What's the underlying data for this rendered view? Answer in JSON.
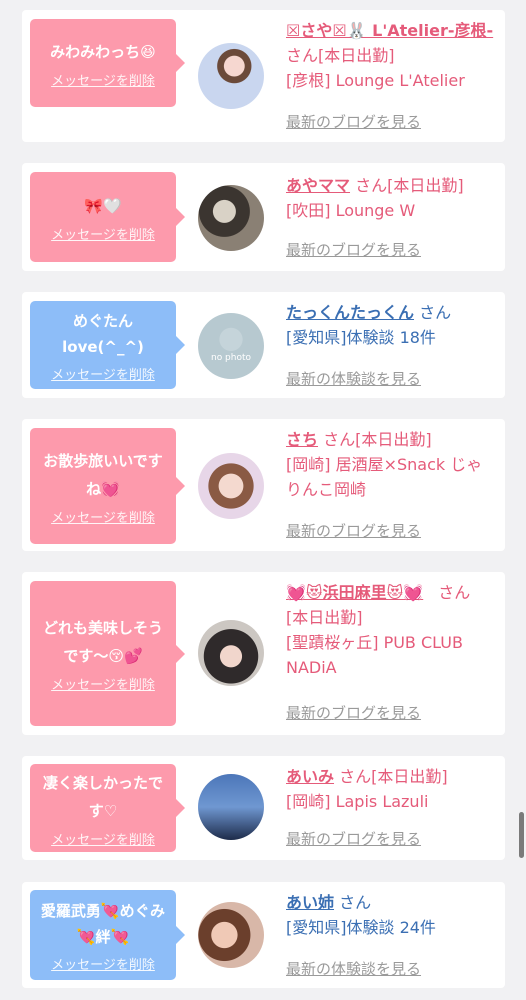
{
  "cards": [
    {
      "bubble_color": "#fd9aac",
      "message": "みわみわっち😆",
      "delete_label": "メッセージを削除",
      "name": "☒さや☒🐰 L'Atelier-彦根-",
      "san": " さん[本日出勤]",
      "detail": "[彦根] Lounge L'Atelier",
      "link": "最新のブログを見る"
    },
    {
      "bubble_color": "#fd9aac",
      "message": "🎀🤍",
      "delete_label": "メッセージを削除",
      "name": "あやママ",
      "san": " さん[本日出勤]",
      "detail": "[吹田] Lounge W",
      "link": "最新のブログを見る"
    },
    {
      "bubble_color": "#8dbdf8",
      "message": "めぐたん love(^_^)",
      "delete_label": "メッセージを削除",
      "name": "たっくんたっくん",
      "san": " さん",
      "detail": "[愛知県]体験談 18件",
      "link": "最新の体験談を見る",
      "avatar_text": "no photo"
    },
    {
      "bubble_color": "#fd9aac",
      "message": "お散歩旅いいですね💓",
      "delete_label": "メッセージを削除",
      "name": "さち",
      "san": " さん[本日出勤]",
      "detail": "[岡崎] 居酒屋×Snack じゃりんこ岡崎",
      "link": "最新のブログを見る"
    },
    {
      "bubble_color": "#fd9aac",
      "message": "どれも美味しそうです〜😚💕",
      "delete_label": "メッセージを削除",
      "name": "💓😻浜田麻里😻💓",
      "san": " さん",
      "status": "[本日出勤]",
      "detail": "[聖蹟桜ヶ丘] PUB CLUB NADiA",
      "link": "最新のブログを見る"
    },
    {
      "bubble_color": "#fd9aac",
      "message": "凄く楽しかったです♡",
      "delete_label": "メッセージを削除",
      "name": "あいみ",
      "san": " さん[本日出勤]",
      "detail": "[岡崎] Lapis Lazuli",
      "link": "最新のブログを見る"
    },
    {
      "bubble_color": "#8dbdf8",
      "message": "愛羅武勇💘めぐみ💘絆💘",
      "delete_label": "メッセージを削除",
      "name": "あい姉",
      "san": " さん",
      "detail": "[愛知県]体験談 24件",
      "link": "最新の体験談を見る"
    }
  ]
}
